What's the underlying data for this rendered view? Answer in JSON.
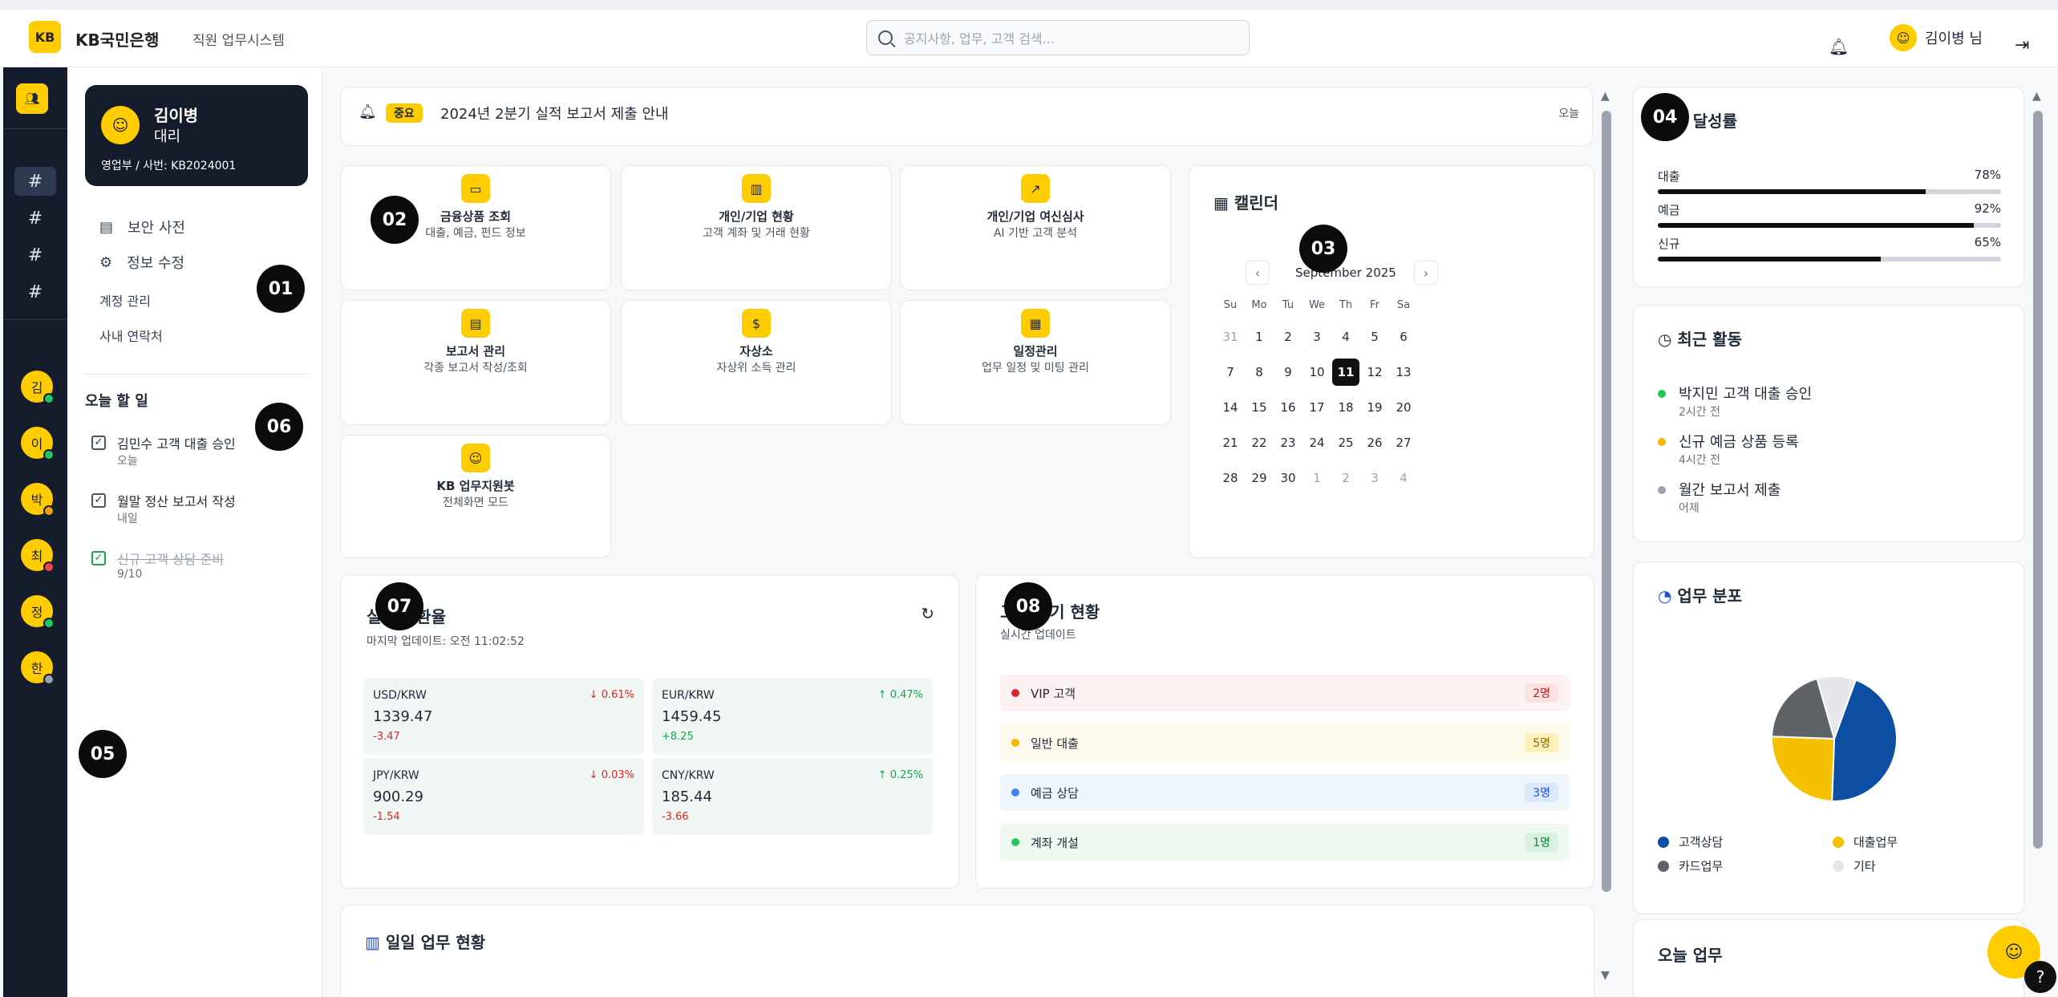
{
  "header": {
    "logo": "KB",
    "brand": "KB국민은행",
    "subtitle": "직원 업무시스템",
    "search_placeholder": "공지사항, 업무, 고객 검색...",
    "user_name": "김이병 님"
  },
  "rail": {
    "avatars": [
      {
        "initial": "김",
        "status": "#22c55e"
      },
      {
        "initial": "이",
        "status": "#22c55e"
      },
      {
        "initial": "박",
        "status": "#f59e0b"
      },
      {
        "initial": "최",
        "status": "#ef4444"
      },
      {
        "initial": "정",
        "status": "#22c55e"
      },
      {
        "initial": "한",
        "status": "#9ca3af"
      }
    ]
  },
  "profile": {
    "name": "김이병",
    "rank": "대리",
    "dept": "영업부 / 사번: KB2024001"
  },
  "menu": {
    "security_dict": "보안 사전",
    "edit_info": "정보 수정",
    "account": "계정 관리",
    "contacts": "사내 연락처"
  },
  "todo": {
    "title": "오늘 할 일",
    "items": [
      {
        "text": "김민수 고객 대출 승인",
        "sub": "오늘",
        "done": false
      },
      {
        "text": "월말 정산 보고서 작성",
        "sub": "내일",
        "done": false
      },
      {
        "text": "신규 고객 상담 준비",
        "sub": "9/10",
        "done": true
      }
    ]
  },
  "notice": {
    "tag": "중요",
    "text": "2024년 2분기 실적 보고서 제출 안내",
    "date": "오늘"
  },
  "tiles": [
    {
      "icon": "card-icon",
      "glyph": "▭",
      "title": "금융상품 조회",
      "sub": "대출, 예금, 펀드 정보"
    },
    {
      "icon": "bar-chart-icon",
      "glyph": "▥",
      "title": "개인/기업 현황",
      "sub": "고객 계좌 및 거래 현황"
    },
    {
      "icon": "trend-icon",
      "glyph": "↗",
      "title": "개인/기업 여신심사",
      "sub": "AI 기반 고객 분석"
    },
    {
      "icon": "document-icon",
      "glyph": "▤",
      "title": "보고서 관리",
      "sub": "각종 보고서 작성/조회"
    },
    {
      "icon": "dollar-icon",
      "glyph": "$",
      "title": "자상소",
      "sub": "자상위 소득 관리"
    },
    {
      "icon": "calendar-icon",
      "glyph": "▦",
      "title": "일정관리",
      "sub": "업무 일정 및 미팅 관리"
    },
    {
      "icon": "bot-icon",
      "glyph": "☺",
      "title": "KB 업무지원봇",
      "sub": "전체화면 모드"
    }
  ],
  "calendar": {
    "title": "캘린더",
    "month": "September 2025",
    "weekdays": [
      "Su",
      "Mo",
      "Tu",
      "We",
      "Th",
      "Fr",
      "Sa"
    ],
    "days": [
      "31",
      "1",
      "2",
      "3",
      "4",
      "5",
      "6",
      "7",
      "8",
      "9",
      "10",
      "11",
      "12",
      "13",
      "14",
      "15",
      "16",
      "17",
      "18",
      "19",
      "20",
      "21",
      "22",
      "23",
      "24",
      "25",
      "26",
      "27",
      "28",
      "29",
      "30",
      "1",
      "2",
      "3",
      "4"
    ],
    "today": "11"
  },
  "fx": {
    "title": "실시간 환율",
    "updated": "마지막 업데이트: 오전 11:02:52",
    "rates": [
      {
        "pair": "USD/KRW",
        "value": "1339.47",
        "change": "-3.47",
        "pct": "↓ 0.61%",
        "up": false
      },
      {
        "pair": "EUR/KRW",
        "value": "1459.45",
        "change": "+8.25",
        "pct": "↑ 0.47%",
        "up": true
      },
      {
        "pair": "JPY/KRW",
        "value": "900.29",
        "change": "-1.54",
        "pct": "↓ 0.03%",
        "up": false
      },
      {
        "pair": "CNY/KRW",
        "value": "185.44",
        "change": "-3.66",
        "pct": "↑ 0.25%",
        "up": true
      }
    ]
  },
  "waiting": {
    "title": "고객 대기 현황",
    "sub": "실시간 업데이트",
    "items": [
      {
        "label": "VIP 고객",
        "count": "2명",
        "dot": "#dc2626",
        "bg": "#fdf2f2",
        "cbg": "#fde2e2",
        "cfg": "#b91c1c"
      },
      {
        "label": "일반 대출",
        "count": "5명",
        "dot": "#f5b800",
        "bg": "#fdfaeb",
        "cbg": "#fdf0b8",
        "cfg": "#8a6a00"
      },
      {
        "label": "예금 상담",
        "count": "3명",
        "dot": "#3b82f6",
        "bg": "#eff5fd",
        "cbg": "#dbe8fc",
        "cfg": "#1d4ed8"
      },
      {
        "label": "계좌 개설",
        "count": "1명",
        "dot": "#22c55e",
        "bg": "#eff8f1",
        "cbg": "#d9f2df",
        "cfg": "#15803d"
      }
    ]
  },
  "daily": {
    "title": "일일 업무 현황"
  },
  "goals": {
    "title": "목표 달성률",
    "items": [
      {
        "label": "대출",
        "pct_label": "78%",
        "pct": 78
      },
      {
        "label": "예금",
        "pct_label": "92%",
        "pct": 92
      },
      {
        "label": "신규",
        "pct_label": "65%",
        "pct": 65
      }
    ]
  },
  "activity": {
    "title": "최근 활동",
    "items": [
      {
        "text": "박지민 고객 대출 승인",
        "time": "2시간 전",
        "dot": "#22c55e"
      },
      {
        "text": "신규 예금 상품 등록",
        "time": "4시간 전",
        "dot": "#f5b800"
      },
      {
        "text": "월간 보고서 제출",
        "time": "어제",
        "dot": "#9ca3af"
      }
    ]
  },
  "chart_data": {
    "type": "pie",
    "title": "업무 분포",
    "series": [
      {
        "name": "고객상담",
        "value": 45,
        "color": "#0b4ea2"
      },
      {
        "name": "대출업무",
        "value": 25,
        "color": "#f5c000"
      },
      {
        "name": "카드업무",
        "value": 20,
        "color": "#5f6368"
      },
      {
        "name": "기타",
        "value": 10,
        "color": "#e5e7eb"
      }
    ]
  },
  "today_tasks": {
    "title": "오늘 업무"
  },
  "badges": [
    "01",
    "02",
    "03",
    "04",
    "05",
    "06",
    "07",
    "08"
  ]
}
